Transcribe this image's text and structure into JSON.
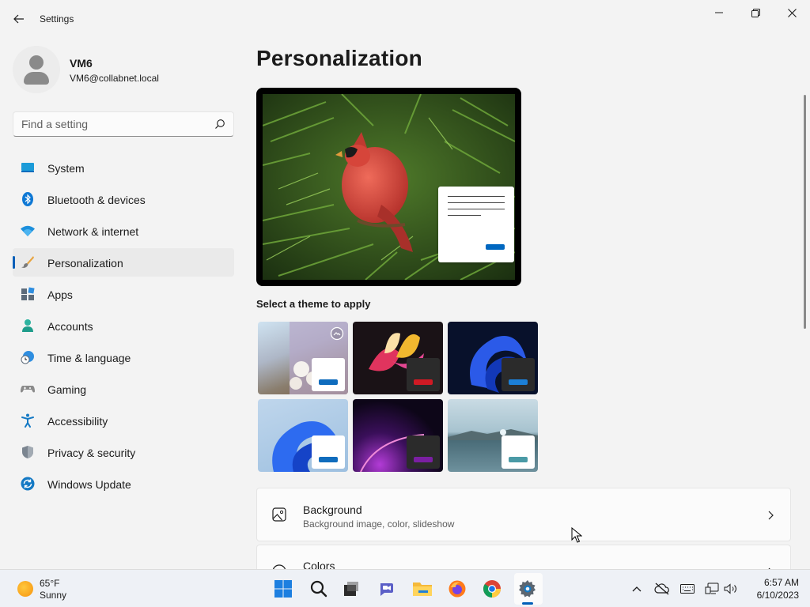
{
  "window": {
    "title": "Settings"
  },
  "profile": {
    "name": "VM6",
    "email": "VM6@collabnet.local"
  },
  "search": {
    "placeholder": "Find a setting"
  },
  "sidebar": {
    "items": [
      {
        "label": "System",
        "icon": "system-icon",
        "active": false
      },
      {
        "label": "Bluetooth & devices",
        "icon": "bluetooth-icon",
        "active": false
      },
      {
        "label": "Network & internet",
        "icon": "wifi-icon",
        "active": false
      },
      {
        "label": "Personalization",
        "icon": "paintbrush-icon",
        "active": true
      },
      {
        "label": "Apps",
        "icon": "apps-icon",
        "active": false
      },
      {
        "label": "Accounts",
        "icon": "accounts-icon",
        "active": false
      },
      {
        "label": "Time & language",
        "icon": "clock-globe-icon",
        "active": false
      },
      {
        "label": "Gaming",
        "icon": "gamepad-icon",
        "active": false
      },
      {
        "label": "Accessibility",
        "icon": "accessibility-icon",
        "active": false
      },
      {
        "label": "Privacy & security",
        "icon": "shield-icon",
        "active": false
      },
      {
        "label": "Windows Update",
        "icon": "update-icon",
        "active": false
      }
    ]
  },
  "main": {
    "title": "Personalization",
    "themes_label": "Select a theme to apply",
    "cards": [
      {
        "title": "Background",
        "subtitle": "Background image, color, slideshow",
        "icon": "image-icon"
      },
      {
        "title": "Colors",
        "subtitle": "",
        "icon": "palette-icon"
      }
    ]
  },
  "taskbar": {
    "weather": {
      "temp": "65°F",
      "condition": "Sunny"
    },
    "time": "6:57 AM",
    "date": "6/10/2023"
  },
  "colors": {
    "accent": "#005fb8",
    "background": "#f3f3f3"
  }
}
